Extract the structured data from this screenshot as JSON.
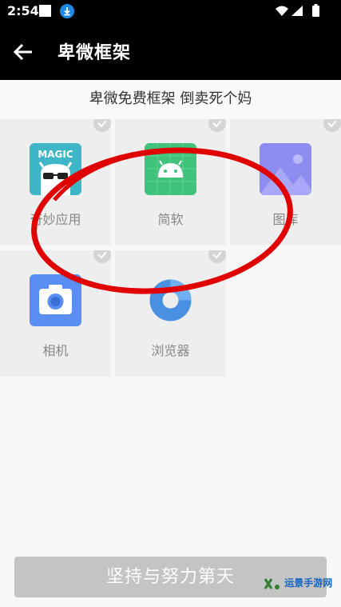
{
  "status": {
    "time": "2:54"
  },
  "appbar": {
    "title": "卑微框架"
  },
  "subtitle": "卑微免费框架 倒卖死个妈",
  "apps": [
    {
      "label": "奇妙应用",
      "icon": "magic-app-icon",
      "icon_text": "MAGIC"
    },
    {
      "label": "简软",
      "icon": "android-icon"
    },
    {
      "label": "图库",
      "icon": "gallery-icon"
    },
    {
      "label": "相机",
      "icon": "camera-icon"
    },
    {
      "label": "浏览器",
      "icon": "browser-icon"
    }
  ],
  "bottom_button": "坚持与努力第天",
  "watermark": "运景手游网",
  "colors": {
    "annotation": "#e00000",
    "button": "#c4c4c4",
    "appbar": "#000000"
  }
}
